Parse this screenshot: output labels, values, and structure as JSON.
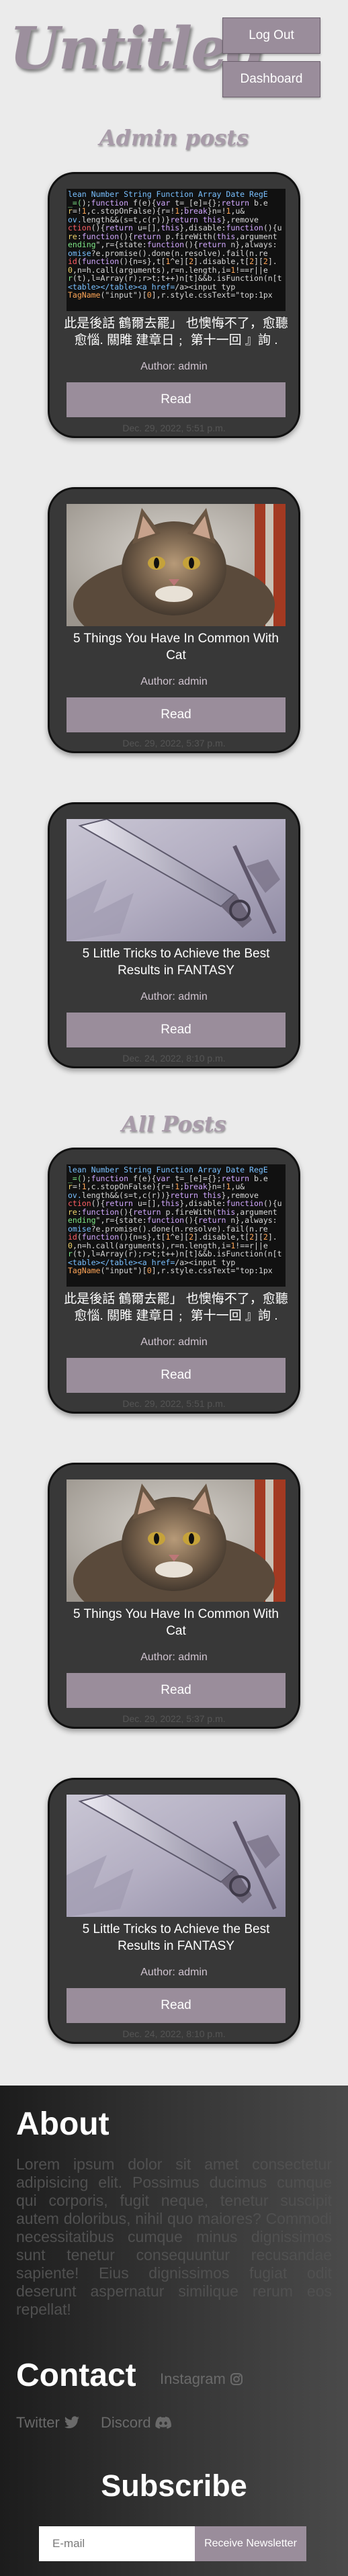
{
  "header": {
    "logo": "Untitled",
    "logout_label": "Log Out",
    "dashboard_label": "Dashboard"
  },
  "admin_section": {
    "title": "Admin posts",
    "posts": [
      {
        "title": "此是後話 鶴爾去罷」 也懊悔不了，愈聽愈惱. 關睢 建章日﹔ 第十一回 』詢 .",
        "author": "Author: admin",
        "button": "Read",
        "date": "Dec. 29, 2022, 5:51 p.m."
      },
      {
        "title": "5 Things You Have In Common With Cat",
        "author": "Author: admin",
        "button": "Read",
        "date": "Dec. 29, 2022, 5:37 p.m."
      },
      {
        "title": "5 Little Tricks to Achieve the Best Results in FANTASY",
        "author": "Author: admin",
        "button": "Read",
        "date": "Dec. 24, 2022, 8:10 p.m."
      }
    ]
  },
  "all_section": {
    "title": "All Posts",
    "posts": [
      {
        "title": "此是後話 鶴爾去罷」 也懊悔不了，愈聽愈惱. 關睢 建章日﹔ 第十一回 』詢 .",
        "author": "Author: admin",
        "button": "Read",
        "date": "Dec. 29, 2022, 5:51 p.m."
      },
      {
        "title": "5 Things You Have In Common With Cat",
        "author": "Author: admin",
        "button": "Read",
        "date": "Dec. 29, 2022, 5:37 p.m."
      },
      {
        "title": "5 Little Tricks to Achieve the Best Results in FANTASY",
        "author": "Author: admin",
        "button": "Read",
        "date": "Dec. 24, 2022, 8:10 p.m."
      }
    ]
  },
  "footer": {
    "about_title": "About",
    "about_text": "Lorem ipsum dolor sit amet consectetur adipisicing elit. Possimus ducimus cumque qui corporis, fugit neque, tenetur suscipit autem doloribus, nihil quo maiores? Commodi necessitatibus cumque minus dignissimos sunt tenetur consequuntur recusandae sapiente! Eius dignissimos fugiat odit deserunt aspernatur similique rerum eos repellat!",
    "contact_title": "Contact",
    "instagram": "Instagram",
    "twitter": "Twitter",
    "discord": "Discord",
    "subscribe_title": "Subscribe",
    "email_placeholder": "E-mail",
    "subscribe_button": "Receive Newsletter"
  },
  "colors": {
    "accent": "#9a8d9b",
    "card_bg": "#383838",
    "page_bg": "#ebebeb"
  }
}
